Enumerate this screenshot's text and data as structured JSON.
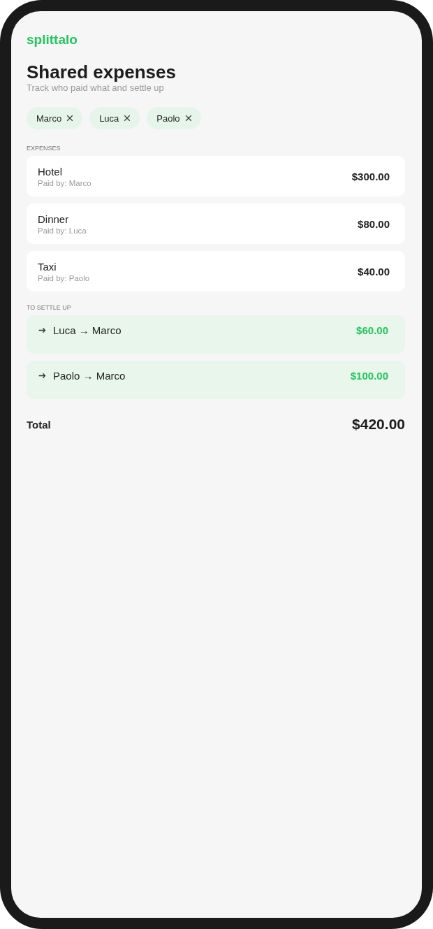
{
  "app": {
    "logo": "splittalo",
    "title": "Shared expenses",
    "subtitle": "Track who paid what and settle up"
  },
  "people": [
    {
      "name": "Marco"
    },
    {
      "name": "Luca"
    },
    {
      "name": "Paolo"
    }
  ],
  "expenses": {
    "label": "EXPENSES",
    "items": [
      {
        "title": "Hotel",
        "paid_by": "Paid by: Marco",
        "amount": "$300.00"
      },
      {
        "title": "Dinner",
        "paid_by": "Paid by: Luca",
        "amount": "$80.00"
      },
      {
        "title": "Taxi",
        "paid_by": "Paid by: Paolo",
        "amount": "$40.00"
      }
    ]
  },
  "settle_up": {
    "label": "TO SETTLE UP",
    "items": [
      {
        "text": "Luca → Marco",
        "amount": "$60.00"
      },
      {
        "text": "Paolo → Marco",
        "amount": "$100.00"
      }
    ]
  },
  "total": {
    "label": "Total",
    "amount": "$420.00"
  }
}
